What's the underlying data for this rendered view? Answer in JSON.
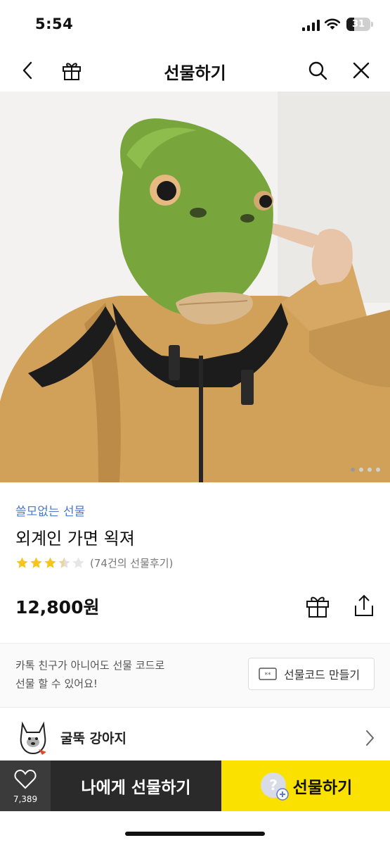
{
  "status_bar": {
    "time": "5:54",
    "battery": "31",
    "battery_level": 0.31
  },
  "header": {
    "title": "선물하기"
  },
  "hero": {
    "total_images": 4,
    "active_index": 0
  },
  "product": {
    "brand": "쓸모없는 선물",
    "name": "외계인 가면 왹져",
    "rating_stars": 3,
    "rating_max": 5,
    "review_label": "(74건의 선물후기)",
    "price": "12,800원"
  },
  "gift_code": {
    "description_line1": "카톡 친구가 아니어도 선물 코드로",
    "description_line2": "선물 할 수 있어요!",
    "button_label": "선물코드 만들기"
  },
  "seller": {
    "name": "굴뚝 강아지"
  },
  "action_bar": {
    "like_count": "7,389",
    "self_gift_label": "나에게 선물하기",
    "gift_label": "선물하기"
  },
  "colors": {
    "brand_blue": "#4a7bd0",
    "kakao_yellow": "#fae100",
    "dark": "#2a2a2a",
    "star": "#f5c518"
  }
}
